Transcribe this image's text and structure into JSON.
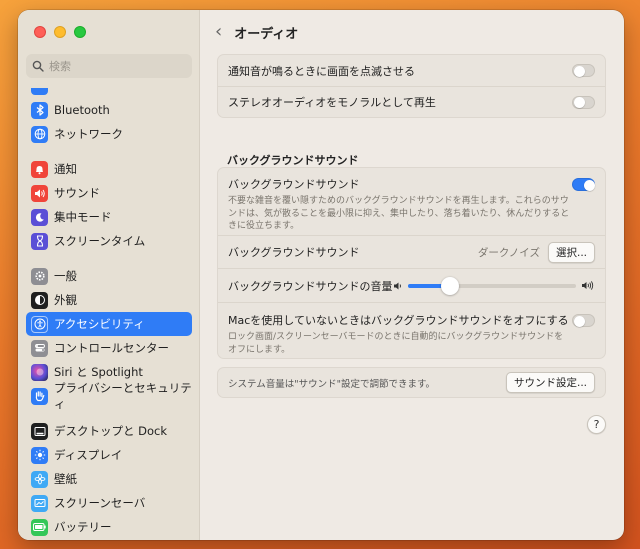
{
  "window": {
    "title": "オーディオ"
  },
  "search": {
    "placeholder": "検索"
  },
  "sidebar": {
    "items": [
      {
        "label": "Bluetooth",
        "icon": "bluetooth-icon",
        "color": "#2f7cf6"
      },
      {
        "label": "ネットワーク",
        "icon": "globe-icon",
        "color": "#2f7cf6"
      },
      {
        "label": "通知",
        "icon": "bell-icon",
        "color": "#f0453a"
      },
      {
        "label": "サウンド",
        "icon": "speaker-icon",
        "color": "#f0453a"
      },
      {
        "label": "集中モード",
        "icon": "moon-icon",
        "color": "#5a4fd6"
      },
      {
        "label": "スクリーンタイム",
        "icon": "hourglass-icon",
        "color": "#5a4fd6"
      },
      {
        "label": "一般",
        "icon": "gear-icon",
        "color": "#8e8e93"
      },
      {
        "label": "外観",
        "icon": "appearance-icon",
        "color": "#1f1f1f"
      },
      {
        "label": "アクセシビリティ",
        "icon": "accessibility-icon",
        "color": "#2f7cf6"
      },
      {
        "label": "コントロールセンター",
        "icon": "control-center-icon",
        "color": "#8e8e93"
      },
      {
        "label": "Siri と Spotlight",
        "icon": "siri-icon",
        "color": "#3a3a3c"
      },
      {
        "label": "プライバシーとセキュリティ",
        "icon": "hand-icon",
        "color": "#2f7cf6"
      },
      {
        "label": "デスクトップと Dock",
        "icon": "dock-icon",
        "color": "#1f1f1f"
      },
      {
        "label": "ディスプレイ",
        "icon": "sun-icon",
        "color": "#2f7cf6"
      },
      {
        "label": "壁紙",
        "icon": "flower-icon",
        "color": "#3fa9f5"
      },
      {
        "label": "スクリーンセーバ",
        "icon": "screensaver-icon",
        "color": "#3fa9f5"
      },
      {
        "label": "バッテリー",
        "icon": "battery-icon",
        "color": "#34c759"
      }
    ]
  },
  "settings": {
    "flash_screen": {
      "label": "通知音が鳴るときに画面を点滅させる",
      "on": false
    },
    "mono_audio": {
      "label": "ステレオオーディオをモノラルとして再生",
      "on": false
    },
    "section_title": "バックグラウンドサウンド",
    "bg_sound": {
      "label": "バックグラウンドサウンド",
      "description": "不要な雑音を覆い隠すためのバックグラウンドサウンドを再生します。これらのサウンドは、気が散ることを最小限に抑え、集中したり、落ち着いたり、休んだりするときに役立ちます。",
      "on": true
    },
    "bg_sound_choice": {
      "label": "バックグラウンドサウンド",
      "value": "ダークノイズ",
      "button": "選択..."
    },
    "bg_volume": {
      "label": "バックグラウンドサウンドの音量",
      "level": 0.25
    },
    "mac_idle": {
      "label": "Macを使用していないときはバックグラウンドサウンドをオフにする",
      "description": "ロック画面/スクリーンセーバモードのときに自動的にバックグラウンドサウンドをオフにします。",
      "on": false
    },
    "system_volume": {
      "text": "システム音量は\"サウンド\"設定で調節できます。",
      "button": "サウンド設定..."
    }
  },
  "help": {
    "label": "?"
  }
}
